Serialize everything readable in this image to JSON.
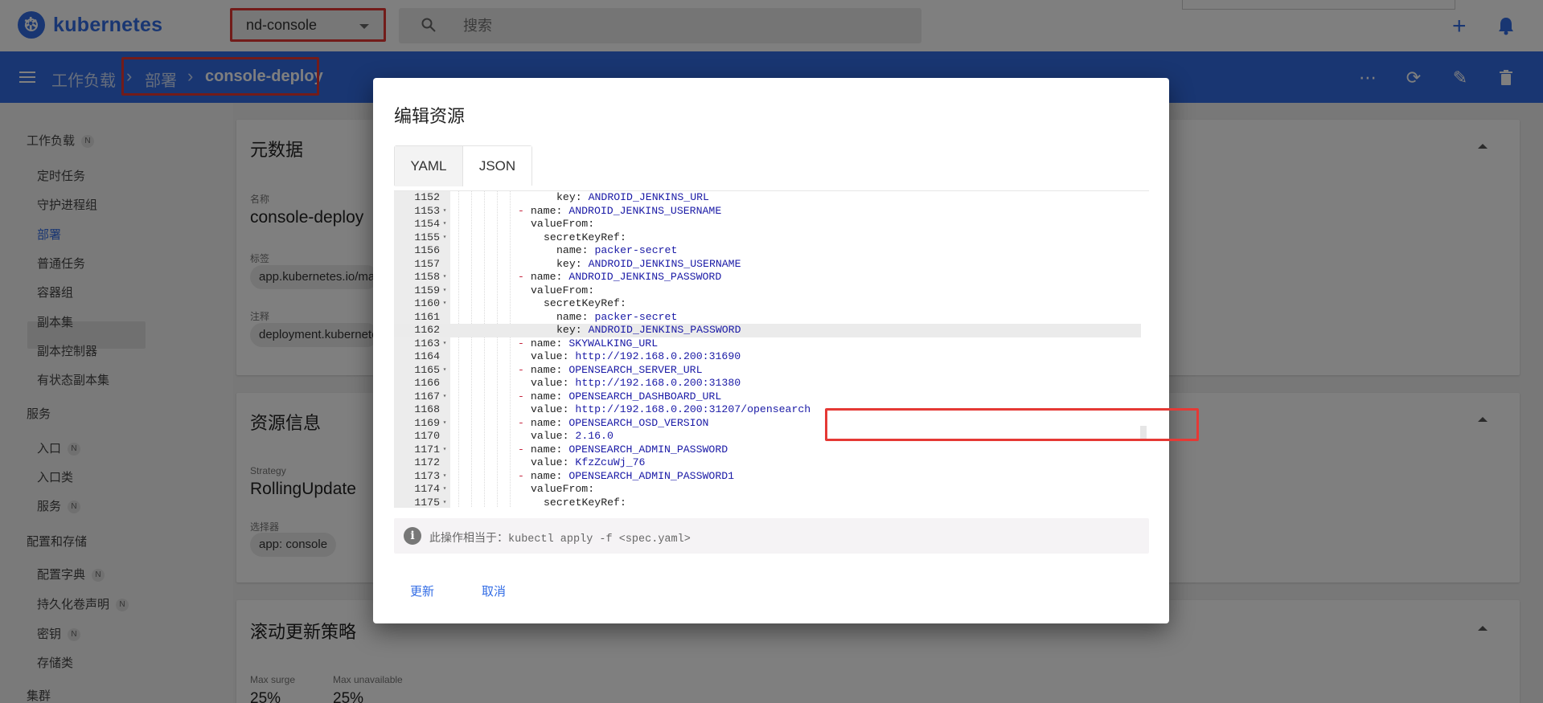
{
  "app": {
    "logo_text": "kubernetes",
    "namespace": "nd-console",
    "search_placeholder": "搜索"
  },
  "breadcrumb": {
    "items": [
      "工作负载",
      "部署"
    ],
    "current": "console-deploy"
  },
  "sidebar": {
    "sections": [
      {
        "label": "工作负载",
        "badge": "N"
      },
      {
        "label": "服务"
      },
      {
        "label": "配置和存储"
      },
      {
        "label": "集群"
      }
    ],
    "items": [
      {
        "label": "定时任务"
      },
      {
        "label": "守护进程组"
      },
      {
        "label": "部署",
        "active": true
      },
      {
        "label": "普通任务"
      },
      {
        "label": "容器组"
      },
      {
        "label": "副本集"
      },
      {
        "label": "副本控制器"
      },
      {
        "label": "有状态副本集"
      },
      {
        "label": "入口",
        "badge": "N"
      },
      {
        "label": "入口类"
      },
      {
        "label": "服务",
        "badge": "N"
      },
      {
        "label": "配置字典",
        "badge": "N"
      },
      {
        "label": "持久化卷声明",
        "badge": "N"
      },
      {
        "label": "密钥",
        "badge": "N"
      },
      {
        "label": "存储类"
      }
    ]
  },
  "cards": {
    "metadata": {
      "title": "元数据",
      "name_label": "名称",
      "name_value": "console-deploy",
      "labels_label": "标签",
      "labels_chip": "app.kubernetes.io/ma",
      "annotations_label": "注释",
      "annotations_chip": "deployment.kubernete"
    },
    "resource": {
      "title": "资源信息",
      "strategy_label": "Strategy",
      "strategy_value": "RollingUpdate",
      "selector_label": "选择器",
      "selector_chip": "app: console"
    },
    "rolling": {
      "title": "滚动更新策略",
      "max_surge_label": "Max surge",
      "max_surge_value": "25%",
      "max_unavailable_label": "Max unavailable",
      "max_unavailable_value": "25%"
    }
  },
  "dialog": {
    "title": "编辑资源",
    "tabs": [
      "YAML",
      "JSON"
    ],
    "active_tab": "YAML",
    "info_text": "此操作相当于：",
    "info_command": "kubectl apply -f <spec.yaml>",
    "update_button": "更新",
    "cancel_button": "取消"
  },
  "editor_lines": [
    {
      "n": "1152",
      "fold": false,
      "dash": false,
      "key": "key: ",
      "val": "ANDROID_JENKINS_URL",
      "hl": false
    },
    {
      "n": "1153",
      "fold": true,
      "dash": true,
      "key": "name: ",
      "val": "ANDROID_JENKINS_USERNAME",
      "hl": false
    },
    {
      "n": "1154",
      "fold": true,
      "dash": false,
      "key": "valueFrom:",
      "val": "",
      "hl": false
    },
    {
      "n": "1155",
      "fold": true,
      "dash": false,
      "key": "secretKeyRef:",
      "val": "",
      "hl": false
    },
    {
      "n": "1156",
      "fold": false,
      "dash": false,
      "key": "name: ",
      "val": "packer-secret",
      "hl": false
    },
    {
      "n": "1157",
      "fold": false,
      "dash": false,
      "key": "key: ",
      "val": "ANDROID_JENKINS_USERNAME",
      "hl": false
    },
    {
      "n": "1158",
      "fold": true,
      "dash": true,
      "key": "name: ",
      "val": "ANDROID_JENKINS_PASSWORD",
      "hl": false
    },
    {
      "n": "1159",
      "fold": true,
      "dash": false,
      "key": "valueFrom:",
      "val": "",
      "hl": false
    },
    {
      "n": "1160",
      "fold": true,
      "dash": false,
      "key": "secretKeyRef:",
      "val": "",
      "hl": false
    },
    {
      "n": "1161",
      "fold": false,
      "dash": false,
      "key": "name: ",
      "val": "packer-secret",
      "hl": false
    },
    {
      "n": "1162",
      "fold": false,
      "dash": false,
      "key": "key: ",
      "val": "ANDROID_JENKINS_PASSWORD",
      "hl": true
    },
    {
      "n": "1163",
      "fold": true,
      "dash": true,
      "key": "name: ",
      "val": "SKYWALKING_URL",
      "hl": false
    },
    {
      "n": "1164",
      "fold": false,
      "dash": false,
      "key": "value: ",
      "val": "http://192.168.0.200:31690",
      "hl": false
    },
    {
      "n": "1165",
      "fold": true,
      "dash": true,
      "key": "name: ",
      "val": "OPENSEARCH_SERVER_URL",
      "hl": false
    },
    {
      "n": "1166",
      "fold": false,
      "dash": false,
      "key": "value: ",
      "val": "http://192.168.0.200:31380",
      "hl": false
    },
    {
      "n": "1167",
      "fold": true,
      "dash": true,
      "key": "name: ",
      "val": "OPENSEARCH_DASHBOARD_URL",
      "hl": false
    },
    {
      "n": "1168",
      "fold": false,
      "dash": false,
      "key": "value: ",
      "val": "http://192.168.0.200:31207/opensearch",
      "hl": false
    },
    {
      "n": "1169",
      "fold": true,
      "dash": true,
      "key": "name: ",
      "val": "OPENSEARCH_OSD_VERSION",
      "hl": false
    },
    {
      "n": "1170",
      "fold": false,
      "dash": false,
      "key": "value: ",
      "val": "2.16.0",
      "hl": false
    },
    {
      "n": "1171",
      "fold": true,
      "dash": true,
      "key": "name: ",
      "val": "OPENSEARCH_ADMIN_PASSWORD",
      "hl": false
    },
    {
      "n": "1172",
      "fold": false,
      "dash": false,
      "key": "value: ",
      "val": "KfzZcuWj_76",
      "hl": false
    },
    {
      "n": "1173",
      "fold": true,
      "dash": true,
      "key": "name: ",
      "val": "OPENSEARCH_ADMIN_PASSWORD1",
      "hl": false
    },
    {
      "n": "1174",
      "fold": true,
      "dash": false,
      "key": "valueFrom:",
      "val": "",
      "hl": false
    },
    {
      "n": "1175",
      "fold": true,
      "dash": false,
      "key": "secretKeyRef:",
      "val": "",
      "hl": false
    }
  ]
}
